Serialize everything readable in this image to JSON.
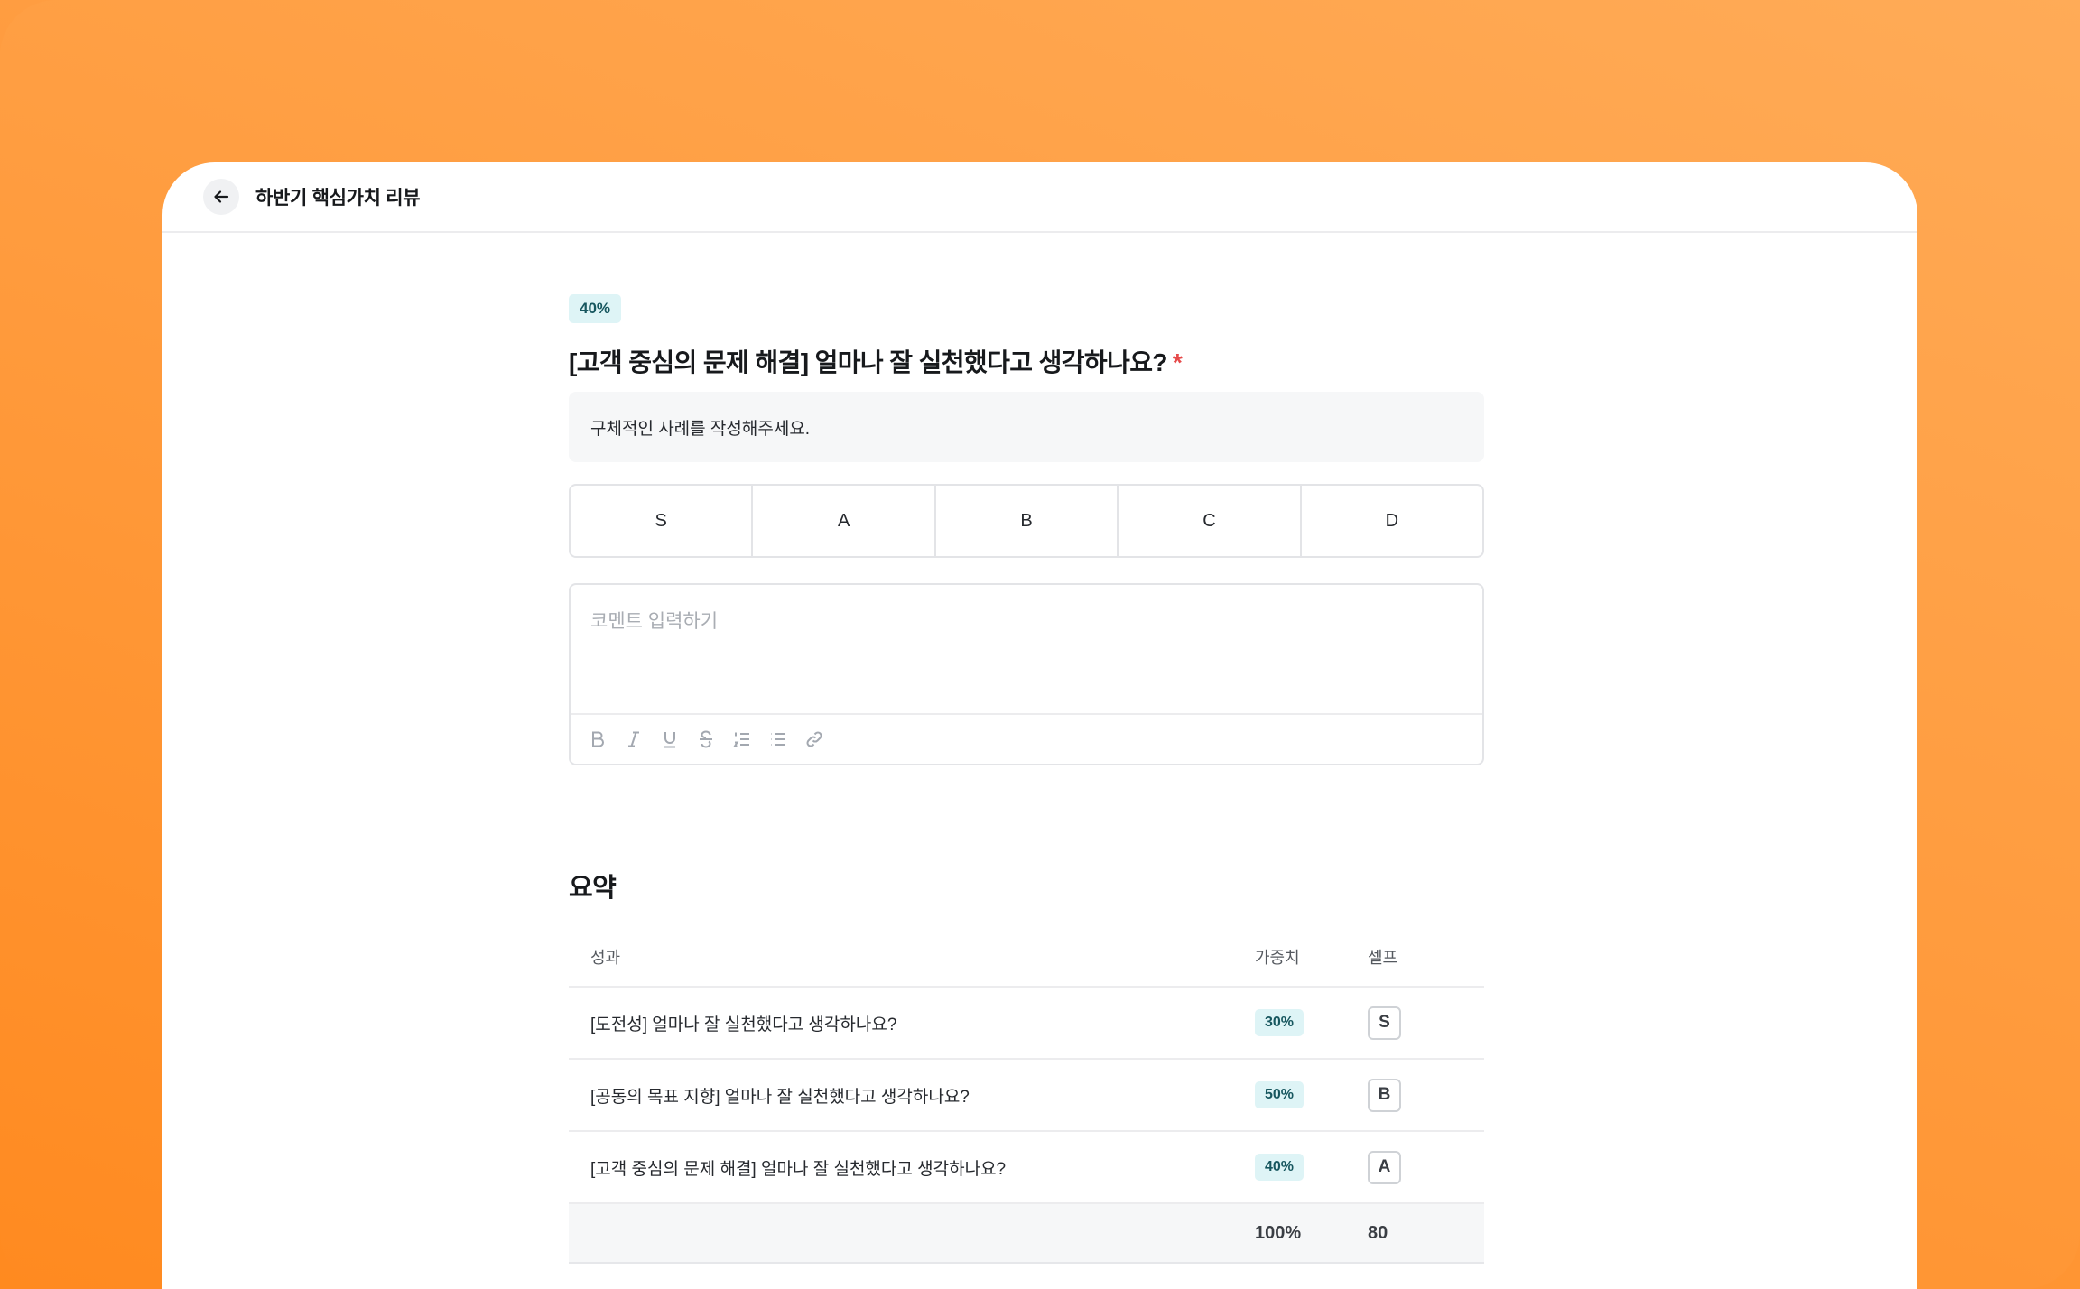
{
  "header": {
    "title": "하반기 핵심가치 리뷰"
  },
  "question": {
    "weight": "40%",
    "title": "[고객 중심의 문제 해결] 얼마나 잘 실천했다고 생각하나요?",
    "required_mark": "*",
    "guide": "구체적인 사례를 작성해주세요.",
    "grades": [
      "S",
      "A",
      "B",
      "C",
      "D"
    ],
    "comment_placeholder": "코멘트 입력하기"
  },
  "editor_toolbar": [
    "bold-icon",
    "italic-icon",
    "underline-icon",
    "strikethrough-icon",
    "ordered-list-icon",
    "bullet-list-icon",
    "link-icon"
  ],
  "summary": {
    "title": "요약",
    "columns": {
      "item": "성과",
      "weight": "가중치",
      "self": "셀프"
    },
    "rows": [
      {
        "item": "[도전성] 얼마나 잘 실천했다고 생각하나요?",
        "weight": "30%",
        "self": "S"
      },
      {
        "item": "[공동의 목표 지향] 얼마나 잘 실천했다고 생각하나요?",
        "weight": "50%",
        "self": "B"
      },
      {
        "item": "[고객 중심의 문제 해결] 얼마나 잘 실천했다고 생각하나요?",
        "weight": "40%",
        "self": "A"
      }
    ],
    "total": {
      "weight": "100%",
      "self": "80"
    }
  }
}
